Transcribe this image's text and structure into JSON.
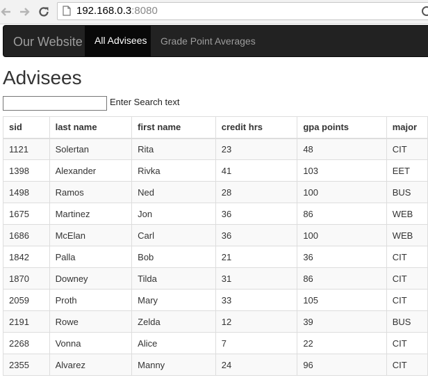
{
  "browser": {
    "url_host": "192.168.0.3",
    "url_port": ":8080"
  },
  "navbar": {
    "brand": "Our Website",
    "items": [
      {
        "label": "All Advisees",
        "active": true
      },
      {
        "label": "Grade Point Averages",
        "active": false
      }
    ]
  },
  "page": {
    "title": "Advisees",
    "search": {
      "value": "",
      "label": "Enter Search text"
    }
  },
  "table": {
    "columns": [
      "sid",
      "last name",
      "first name",
      "credit hrs",
      "gpa points",
      "major"
    ],
    "rows": [
      [
        "1121",
        "Solertan",
        "Rita",
        "23",
        "48",
        "CIT"
      ],
      [
        "1398",
        "Alexander",
        "Rivka",
        "41",
        "103",
        "EET"
      ],
      [
        "1498",
        "Ramos",
        "Ned",
        "28",
        "100",
        "BUS"
      ],
      [
        "1675",
        "Martinez",
        "Jon",
        "36",
        "86",
        "WEB"
      ],
      [
        "1686",
        "McElan",
        "Carl",
        "36",
        "100",
        "WEB"
      ],
      [
        "1842",
        "Palla",
        "Bob",
        "21",
        "36",
        "CIT"
      ],
      [
        "1870",
        "Downey",
        "Tilda",
        "31",
        "86",
        "CIT"
      ],
      [
        "2059",
        "Proth",
        "Mary",
        "33",
        "105",
        "CIT"
      ],
      [
        "2191",
        "Rowe",
        "Zelda",
        "12",
        "39",
        "BUS"
      ],
      [
        "2268",
        "Vonna",
        "Alice",
        "7",
        "22",
        "CIT"
      ],
      [
        "2355",
        "Alvarez",
        "Manny",
        "24",
        "96",
        "CIT"
      ]
    ]
  },
  "icons": {
    "back": "back-arrow-icon",
    "forward": "forward-arrow-icon",
    "reload": "reload-icon",
    "page": "page-icon",
    "menu": "menu-icon"
  },
  "colors": {
    "navbar_bg": "#222222",
    "navbar_active_bg": "#080808",
    "navbar_text": "#9d9d9d",
    "table_stripe": "#f9f9f9",
    "table_border": "#dddddd"
  }
}
